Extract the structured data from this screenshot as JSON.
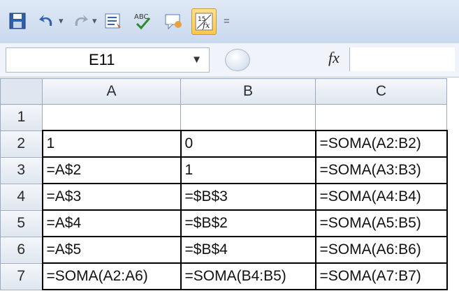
{
  "formula_bar": {
    "name_box": "E11",
    "fx_label": "fx"
  },
  "grid": {
    "columns": [
      "A",
      "B",
      "C"
    ],
    "rows": [
      {
        "num": "1",
        "cells": [
          "",
          "",
          ""
        ]
      },
      {
        "num": "2",
        "cells": [
          "1",
          "0",
          "=SOMA(A2:B2)"
        ]
      },
      {
        "num": "3",
        "cells": [
          "=A$2",
          "1",
          "=SOMA(A3:B3)"
        ]
      },
      {
        "num": "4",
        "cells": [
          "=A$3",
          "=$B$3",
          "=SOMA(A4:B4)"
        ]
      },
      {
        "num": "5",
        "cells": [
          "=A$4",
          "=$B$2",
          "=SOMA(A5:B5)"
        ]
      },
      {
        "num": "6",
        "cells": [
          "=A$5",
          "=$B$4",
          "=SOMA(A6:B6)"
        ]
      },
      {
        "num": "7",
        "cells": [
          "=SOMA(A2:A6)",
          "=SOMA(B4:B5)",
          "=SOMA(A7:B7)"
        ]
      }
    ]
  }
}
